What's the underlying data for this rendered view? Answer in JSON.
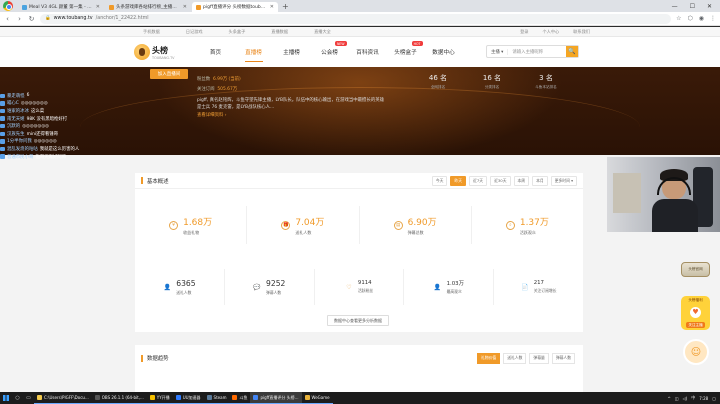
{
  "browser": {
    "tabs": [
      {
        "title": "Meal V3 4GL 颜董 第一集 - 哔哩哔哩",
        "color": "#4aa3df"
      },
      {
        "title": "头条游戏库各站排行榜_主播排行...",
        "color": "#f09a29"
      },
      {
        "title": "pigff直播评分 头榜数据toubang...",
        "color": "#f09a29",
        "active": true
      }
    ],
    "new_tab": "+",
    "window_buttons": [
      "—",
      "☐",
      "✕"
    ],
    "url_host": "www.toubang.tv",
    "url_path": "/anchor/1_22422.html",
    "lock": "🔒"
  },
  "site": {
    "topbar_left": [
      "手机数据",
      "日记游戏",
      "头条盒子",
      "直播数据",
      "直播大全"
    ],
    "topbar_right": [
      "登录",
      "个人中心",
      "联系我们"
    ],
    "logo_text": "头榜",
    "logo_sub": "TOUBANG.TV",
    "nav": [
      {
        "label": "首页"
      },
      {
        "label": "直播榜",
        "active": true
      },
      {
        "label": "主播榜"
      },
      {
        "label": "公会榜",
        "badge": "NEW"
      },
      {
        "label": "百科资讯"
      },
      {
        "label": "头榜盒子",
        "badge": "HOT"
      },
      {
        "label": "数据中心"
      }
    ],
    "search_scope": "主播 ▾",
    "search_placeholder": "请输入主播昵称",
    "search_icon": "🔍"
  },
  "banner": {
    "add_button": "加入直播间",
    "lines": [
      {
        "label": "粉丝数",
        "value": "6.99万 (当前)"
      },
      {
        "label": "关注订阅",
        "value": "505.67万"
      }
    ],
    "description": "pigff, 真名赵铭辉，斗鱼守望先锋主播，LYB队长。队伍中的核心输出，在游戏当中最擅长的英雄是士兵 76 麦克雷，是LYB战队核心人...",
    "more_link": "查看详细资料 ›",
    "ranks": [
      {
        "value": "46 名",
        "label": "全网排名"
      },
      {
        "value": "16 名",
        "label": "分类排名"
      },
      {
        "value": "3 名",
        "label": "斗鱼本站排名"
      }
    ]
  },
  "chat": [
    {
      "name": "暴走萌怪",
      "msg": "6"
    },
    {
      "name": "喵心C",
      "msg": "◎◎◎◎◎◎◎"
    },
    {
      "name": "谁家的冰冰",
      "msg": "这么菜"
    },
    {
      "name": "南无天姬",
      "msg": "98K 没有黑暗枪好打"
    },
    {
      "name": "沉默的",
      "msg": "◎◎◎◎◎◎◎"
    },
    {
      "name": "汉族先生",
      "msg": "mini还得看锤哥"
    },
    {
      "name": "1分半你问我",
      "msg": "◎◎◎◎◎◎"
    },
    {
      "name": "混乱发烧的咕咕",
      "msg": "我就是这么厉害的人"
    },
    {
      "name": "普通市民小哥",
      "msg": "抱哥天赐好阿师"
    }
  ],
  "overview": {
    "title": "基本概述",
    "filters": [
      {
        "label": "今天"
      },
      {
        "label": "昨天",
        "active": true
      },
      {
        "label": "近7天"
      },
      {
        "label": "近30天"
      },
      {
        "label": "本周"
      },
      {
        "label": "本月"
      },
      {
        "label": "更多时间 ▾"
      }
    ],
    "primary": [
      {
        "icon": "¥",
        "icon_name": "coin-icon",
        "value": "1.68万",
        "label": "收益礼物"
      },
      {
        "icon": "🎁",
        "icon_name": "gift-icon",
        "value": "7.04万",
        "label": "送礼人数"
      },
      {
        "icon": "▤",
        "icon_name": "danmaku-icon",
        "value": "6.90万",
        "label": "弹幕总数"
      },
      {
        "icon": "⌕",
        "icon_name": "view-icon",
        "value": "1.37万",
        "label": "活跃观众"
      }
    ],
    "secondary": [
      {
        "icon": "👤",
        "icon_name": "user-icon",
        "value": "6365",
        "label": "送礼人数",
        "small": false
      },
      {
        "icon": "💬",
        "icon_name": "chat-icon",
        "value": "9252",
        "label": "弹幕人数",
        "small": false
      },
      {
        "icon": "♡",
        "icon_name": "heart-icon",
        "value": "9114",
        "label": "活跃粉丝",
        "small": true
      },
      {
        "icon": "👤",
        "icon_name": "audience-icon",
        "value": "1.03万",
        "label": "最高观众",
        "small": true
      },
      {
        "icon": "📄",
        "icon_name": "follow-icon",
        "value": "217",
        "label": "关注订阅增长",
        "small": true
      }
    ],
    "more_button": "数据中心查看更多分析数据"
  },
  "trend": {
    "title": "数据趋势",
    "tabs": [
      {
        "label": "礼物价值",
        "active": true
      },
      {
        "label": "送礼人数"
      },
      {
        "label": "弹幕量"
      },
      {
        "label": "弹幕人数"
      }
    ]
  },
  "side_badges": {
    "rank_badge": "头榜官网",
    "fan_badge_top": "头榜福利",
    "fan_badge_tip": "关注主播",
    "heart": "♥"
  },
  "taskbar": {
    "tasks": [
      {
        "title": "C:\\Users\\PIGFF\\Docu...",
        "color": "#f2c94c"
      },
      {
        "title": "OBS 26.1.1 (64-bit,...",
        "color": "#333"
      },
      {
        "title": "YY开播",
        "color": "#f5c000"
      },
      {
        "title": "UU加速器",
        "color": "#2f7bff"
      },
      {
        "title": "Steam",
        "color": "#1b2838"
      },
      {
        "title": "斗鱼",
        "color": "#ff6a00"
      },
      {
        "title": "pigff直播评分 头榜...",
        "color": "#4285f4",
        "active": true
      },
      {
        "title": "WeGame",
        "color": "#e8b23a"
      }
    ],
    "clock": "7:28",
    "lang": "中"
  }
}
